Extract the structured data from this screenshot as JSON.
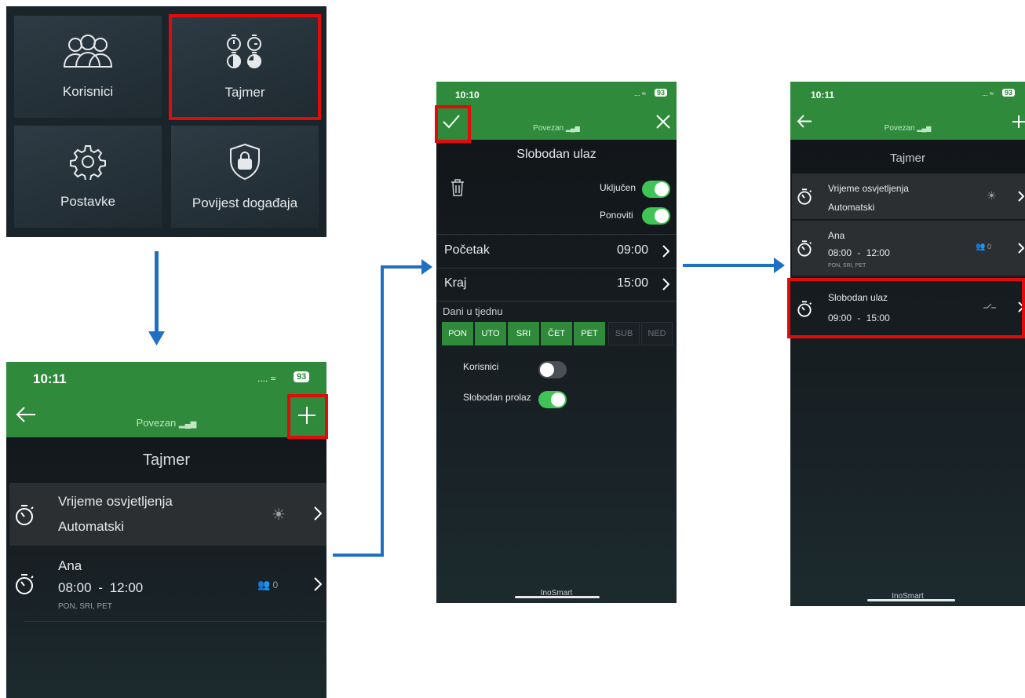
{
  "menu": {
    "tiles": [
      {
        "label": "Korisnici",
        "icon": "users-icon"
      },
      {
        "label": "Tajmer",
        "icon": "timers-icon"
      },
      {
        "label": "Postavke",
        "icon": "gear-icon"
      },
      {
        "label": "Povijest događaja",
        "icon": "shield-lock-icon"
      }
    ]
  },
  "timer_list": {
    "time": "10:11",
    "battery": "93",
    "connection": "Povezan",
    "title": "Tajmer",
    "items": [
      {
        "name": "Vrijeme osvjetljenja",
        "sub": "Automatski",
        "icon": "sun-icon"
      },
      {
        "name": "Ana",
        "start": "08:00",
        "sep": "-",
        "end": "12:00",
        "days": "PON, SRI, PET",
        "count": "0",
        "icon": "users-icon"
      }
    ]
  },
  "edit_timer": {
    "time": "10:10",
    "battery": "93",
    "connection": "Povezan",
    "title": "Slobodan ulaz",
    "enabled_label": "Uključen",
    "repeat_label": "Ponoviti",
    "start_label": "Početak",
    "start_value": "09:00",
    "end_label": "Kraj",
    "end_value": "15:00",
    "days_label": "Dani u tjednu",
    "days": [
      {
        "label": "PON",
        "on": true
      },
      {
        "label": "UTO",
        "on": true
      },
      {
        "label": "SRI",
        "on": true
      },
      {
        "label": "ČET",
        "on": true
      },
      {
        "label": "PET",
        "on": true
      },
      {
        "label": "SUB",
        "on": false
      },
      {
        "label": "NED",
        "on": false
      }
    ],
    "users_label": "Korisnici",
    "users_on": false,
    "free_pass_label": "Slobodan prolaz",
    "free_pass_on": true,
    "brand": "InoSmart"
  },
  "result_list": {
    "time": "10:11",
    "battery": "93",
    "connection": "Povezan",
    "title": "Tajmer",
    "items": [
      {
        "name": "Vrijeme osvjetljenja",
        "sub": "Automatski",
        "icon": "sun-icon"
      },
      {
        "name": "Ana",
        "start": "08:00",
        "sep": "-",
        "end": "12:00",
        "days": "PON, SRI, PET",
        "count": "0",
        "icon": "users-icon"
      },
      {
        "name": "Slobodan ulaz",
        "start": "09:00",
        "sep": "-",
        "end": "15:00",
        "icon": "free-pass-icon"
      }
    ],
    "brand": "InoSmart"
  },
  "colors": {
    "green": "#2f8a3b",
    "highlight": "#e10b0b",
    "arrow": "#1f6fc3",
    "toggle_on": "#3fc455"
  }
}
